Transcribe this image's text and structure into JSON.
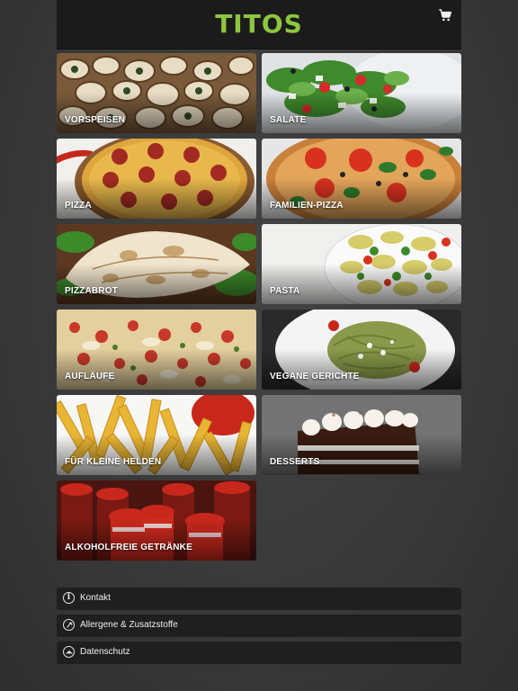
{
  "header": {
    "logo_text": "TITOS",
    "cart_icon": "cart-icon"
  },
  "categories": [
    {
      "label": "VORSPEISEN"
    },
    {
      "label": "SALATE"
    },
    {
      "label": "PIZZA"
    },
    {
      "label": "FAMILIEN-PIZZA"
    },
    {
      "label": "PIZZABROT"
    },
    {
      "label": "PASTA"
    },
    {
      "label": "AUFLÄUFE"
    },
    {
      "label": "VEGANE GERICHTE"
    },
    {
      "label": "FÜR KLEINE HELDEN"
    },
    {
      "label": "DESSERTS"
    },
    {
      "label": "ALKOHOLFREIE GETRÄNKE"
    }
  ],
  "footer_links": [
    {
      "label": "Kontakt",
      "icon": "info-icon"
    },
    {
      "label": "Allergene & Zusatzstoffe",
      "icon": "allergen-icon"
    },
    {
      "label": "Datenschutz",
      "icon": "privacy-icon"
    }
  ],
  "colors": {
    "brand": "#8cc63f",
    "header_bg": "#1b1b1b",
    "page_bg": "#3a3a3a",
    "link_bg": "#1f1f1f"
  }
}
